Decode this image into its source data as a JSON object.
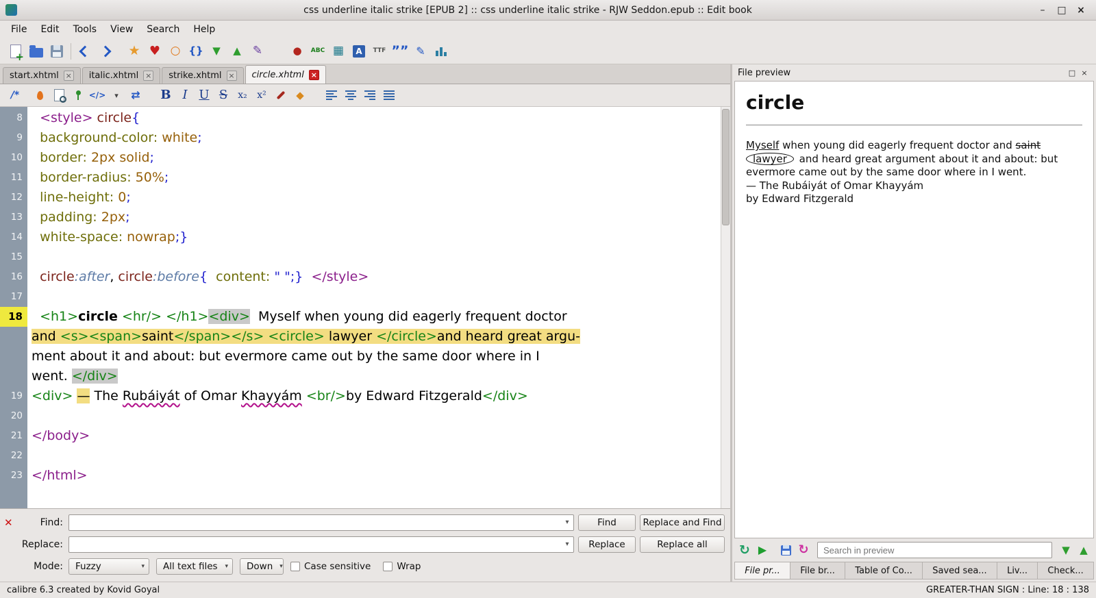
{
  "window": {
    "title": "css underline italic strike [EPUB 2] :: css underline italic strike - RJW Seddon.epub :: Edit book",
    "minimize": "–",
    "maximize": "□",
    "close": "×"
  },
  "menu": [
    "File",
    "Edit",
    "Tools",
    "View",
    "Search",
    "Help"
  ],
  "main_toolbar": [
    {
      "name": "new-file-icon",
      "cls": "ic-newdoc"
    },
    {
      "name": "open-book-icon",
      "cls": "ic-folder"
    },
    {
      "name": "save-icon",
      "cls": "ic-floppy"
    },
    {
      "sep": true
    },
    {
      "name": "back-icon",
      "cls": "ic-chev-l"
    },
    {
      "name": "forward-icon",
      "cls": "ic-chev-r"
    },
    {
      "gap": 12,
      "name": "bookmark-icon",
      "glyph": "★",
      "color": "#e69a2e",
      "size": 19
    },
    {
      "name": "donate-heart-icon",
      "glyph": "♥",
      "color": "#c81f1f",
      "size": 18
    },
    {
      "name": "sync-icon",
      "glyph": "○",
      "color": "#e07b1f",
      "size": 17,
      "bold": true
    },
    {
      "name": "braces-icon",
      "glyph": "{}",
      "color": "#2458c4",
      "size": 15,
      "bold": true
    },
    {
      "name": "arrow-down-icon",
      "glyph": "▼",
      "color": "#2f9e2f",
      "size": 15
    },
    {
      "name": "arrow-up-icon",
      "glyph": "▲",
      "color": "#2f9e2f",
      "size": 15
    },
    {
      "name": "quill-icon",
      "glyph": "✎",
      "color": "#6a3fa0",
      "size": 17
    },
    {
      "gap": 28,
      "name": "check-book-icon",
      "glyph": "●",
      "color": "#b3261e",
      "size": 15
    },
    {
      "name": "spellcheck-icon",
      "glyph": "ABC",
      "color": "#1a7d1a",
      "size": 9,
      "bold": true
    },
    {
      "name": "table-icon",
      "glyph": "▦",
      "color": "#1f7a8c",
      "size": 17
    },
    {
      "name": "manage-fonts-icon",
      "cls": "ic-sqA",
      "glyph": "A"
    },
    {
      "name": "subset-fonts-icon",
      "glyph": "TTF",
      "color": "#50524f",
      "size": 9,
      "bold": true
    },
    {
      "name": "smarten-punctuation-icon",
      "glyph": "””",
      "color": "#2458c4",
      "size": 19,
      "bold": true
    },
    {
      "name": "fix-html-icon",
      "glyph": "✎",
      "color": "#2458c4",
      "size": 16
    },
    {
      "name": "reports-icon",
      "cls": "ic-bars"
    }
  ],
  "tabs": [
    {
      "label": "start.xhtml",
      "active": false,
      "modified": false
    },
    {
      "label": "italic.xhtml",
      "active": false,
      "modified": false
    },
    {
      "label": "strike.xhtml",
      "active": false,
      "modified": false
    },
    {
      "label": "circle.xhtml",
      "active": true,
      "modified": true
    }
  ],
  "editor_toolbar": [
    {
      "name": "comment-icon",
      "glyph": "/*",
      "color": "#2458c4",
      "size": 14,
      "bold": true,
      "italic": true
    },
    {
      "gap": 8,
      "name": "match-icon",
      "cls": "ic-drop"
    },
    {
      "name": "search-file-icon",
      "cls": "ic-magdoc"
    },
    {
      "name": "insert-snippet-icon",
      "cls": "ic-sprout"
    },
    {
      "name": "code-tag-icon",
      "glyph": "</>",
      "color": "#2458c4",
      "size": 12,
      "bold": true
    },
    {
      "name": "code-tag-dropdown-icon",
      "glyph": "▾",
      "color": "#444444",
      "size": 11
    },
    {
      "name": "swap-icon",
      "glyph": "⇄",
      "color": "#2458c4",
      "size": 16,
      "bold": true
    },
    {
      "gap": 16,
      "name": "bold-icon",
      "glyph": "B",
      "color": "#1b3c8c",
      "size": 18,
      "bold": true,
      "serif": true
    },
    {
      "name": "italic-icon",
      "glyph": "I",
      "color": "#1b3c8c",
      "size": 18,
      "italic": true,
      "serif": true
    },
    {
      "name": "underline-icon",
      "glyph": "U",
      "color": "#1b3c8c",
      "size": 18,
      "serif": true,
      "deco": "underline"
    },
    {
      "name": "strikethrough-icon",
      "glyph": "S",
      "color": "#1b3c8c",
      "size": 18,
      "serif": true,
      "deco": "line-through"
    },
    {
      "name": "subscript-icon",
      "glyph": "x₂",
      "color": "#1b3c8c",
      "size": 14,
      "serif": true
    },
    {
      "name": "superscript-icon",
      "glyph": "x²",
      "color": "#1b3c8c",
      "size": 14,
      "serif": true
    },
    {
      "name": "foreground-color-icon",
      "cls": "ic-brush"
    },
    {
      "name": "background-color-icon",
      "glyph": "◆",
      "color": "#d98a1f",
      "size": 15
    },
    {
      "gap": 18,
      "name": "align-left-icon",
      "cls": "ic-align al-left"
    },
    {
      "name": "align-center-icon",
      "cls": "ic-align al-center"
    },
    {
      "name": "align-right-icon",
      "cls": "ic-align al-right"
    },
    {
      "name": "align-justify-icon",
      "cls": "ic-align al-just"
    }
  ],
  "editor": {
    "rows": [
      {
        "num": "8",
        "tokens": [
          {
            "t": "  "
          },
          {
            "t": "<style>",
            "c": "tp"
          },
          {
            "t": " "
          },
          {
            "t": "circle",
            "c": "se"
          },
          {
            "t": "{",
            "c": "pu"
          }
        ]
      },
      {
        "num": "9",
        "tokens": [
          {
            "t": "  "
          },
          {
            "t": "background-color:",
            "c": "pr"
          },
          {
            "t": " "
          },
          {
            "t": "white",
            "c": "vl"
          },
          {
            "t": ";",
            "c": "pu"
          }
        ]
      },
      {
        "num": "10",
        "tokens": [
          {
            "t": "  "
          },
          {
            "t": "border:",
            "c": "pr"
          },
          {
            "t": " "
          },
          {
            "t": "2px",
            "c": "vl"
          },
          {
            "t": " "
          },
          {
            "t": "solid",
            "c": "vl"
          },
          {
            "t": ";",
            "c": "pu"
          }
        ]
      },
      {
        "num": "11",
        "tokens": [
          {
            "t": "  "
          },
          {
            "t": "border-radius:",
            "c": "pr"
          },
          {
            "t": " "
          },
          {
            "t": "50%",
            "c": "vl"
          },
          {
            "t": ";",
            "c": "pu"
          }
        ]
      },
      {
        "num": "12",
        "tokens": [
          {
            "t": "  "
          },
          {
            "t": "line-height:",
            "c": "pr"
          },
          {
            "t": " "
          },
          {
            "t": "0",
            "c": "vl"
          },
          {
            "t": ";",
            "c": "pu"
          }
        ]
      },
      {
        "num": "13",
        "tokens": [
          {
            "t": "  "
          },
          {
            "t": "padding:",
            "c": "pr"
          },
          {
            "t": " "
          },
          {
            "t": "2px",
            "c": "vl"
          },
          {
            "t": ";",
            "c": "pu"
          }
        ]
      },
      {
        "num": "14",
        "tokens": [
          {
            "t": "  "
          },
          {
            "t": "white-space:",
            "c": "pr"
          },
          {
            "t": " "
          },
          {
            "t": "nowrap",
            "c": "vl"
          },
          {
            "t": ";}",
            "c": "pu"
          }
        ]
      },
      {
        "num": "15",
        "tokens": []
      },
      {
        "num": "16",
        "tokens": [
          {
            "t": "  "
          },
          {
            "t": "circle",
            "c": "se"
          },
          {
            "t": ":after",
            "c": "ps"
          },
          {
            "t": ", "
          },
          {
            "t": "circle",
            "c": "se"
          },
          {
            "t": ":before",
            "c": "ps"
          },
          {
            "t": "{",
            "c": "pu"
          },
          {
            "t": "  "
          },
          {
            "t": "content:",
            "c": "pr"
          },
          {
            "t": " "
          },
          {
            "t": "\" \"",
            "c": "st"
          },
          {
            "t": ";}",
            "c": "pu"
          },
          {
            "t": "  "
          },
          {
            "t": "</style>",
            "c": "tp"
          }
        ]
      },
      {
        "num": "17",
        "tokens": []
      },
      {
        "num": "18",
        "cur": true,
        "tokens": [
          {
            "t": "  "
          },
          {
            "t": "<h1>",
            "c": "tg"
          },
          {
            "t": "circle",
            "c": "b"
          },
          {
            "t": " "
          },
          {
            "t": "<hr/>",
            "c": "tg"
          },
          {
            "t": " "
          },
          {
            "t": "</h1>",
            "c": "tg"
          },
          {
            "t": "<div>",
            "c": "tg bgg"
          },
          {
            "t": "  Myself when young did eagerly frequent doctor"
          }
        ]
      },
      {
        "tokens": [
          {
            "t": "and ",
            "c": "bgy"
          },
          {
            "t": "<s>",
            "c": "tg bgy"
          },
          {
            "t": "<span>",
            "c": "tg bgy"
          },
          {
            "t": "saint",
            "c": "bgy"
          },
          {
            "t": "</span>",
            "c": "tg bgy"
          },
          {
            "t": "</s>",
            "c": "tg bgy"
          },
          {
            "t": " ",
            "c": "bgy"
          },
          {
            "t": "<circle>",
            "c": "tg bgy"
          },
          {
            "t": " lawyer ",
            "c": "bgy"
          },
          {
            "t": "</circle>",
            "c": "tg bgy"
          },
          {
            "t": "and heard great argu-",
            "c": "bgy"
          }
        ]
      },
      {
        "tokens": [
          {
            "t": "ment about it and about: but evermore came out by the same door where in I"
          }
        ]
      },
      {
        "tokens": [
          {
            "t": "went. "
          },
          {
            "t": "</div>",
            "c": "tg bgg"
          }
        ]
      },
      {
        "num": "19",
        "tokens": [
          {
            "t": "<div>",
            "c": "tg"
          },
          {
            "t": " "
          },
          {
            "t": "—",
            "c": "bgy"
          },
          {
            "t": " The "
          },
          {
            "t": "Rubáiyát",
            "c": "sq"
          },
          {
            "t": " of Omar "
          },
          {
            "t": "Khayyám",
            "c": "sq"
          },
          {
            "t": " "
          },
          {
            "t": "<br/>",
            "c": "tg"
          },
          {
            "t": "by Edward Fitzgerald"
          },
          {
            "t": "</div>",
            "c": "tg"
          }
        ]
      },
      {
        "num": "20",
        "tokens": []
      },
      {
        "num": "21",
        "tokens": [
          {
            "t": "</body>",
            "c": "tp"
          }
        ]
      },
      {
        "num": "22",
        "tokens": []
      },
      {
        "num": "23",
        "tokens": [
          {
            "t": "</html>",
            "c": "tp"
          }
        ]
      }
    ]
  },
  "find_panel": {
    "close_glyph": "✕",
    "find_label": "Find:",
    "replace_label": "Replace:",
    "mode_label": "Mode:",
    "find_value": "",
    "replace_value": "",
    "find_button": "Find",
    "replace_and_find_button": "Replace and Find",
    "replace_button": "Replace",
    "replace_all_button": "Replace all",
    "mode_value": "Fuzzy",
    "scope_value": "All text files",
    "direction_value": "Down",
    "case_sensitive_label": "Case sensitive",
    "wrap_label": "Wrap"
  },
  "preview": {
    "panel_title": "File preview",
    "float_glyph": "□",
    "close_glyph": "×",
    "heading": "circle",
    "lines": [
      [
        {
          "t": "Myself",
          "st": "u"
        },
        {
          "t": " when young did eagerly frequent doctor and "
        },
        {
          "t": "saint",
          "st": "s"
        }
      ],
      [
        {
          "t": "lawyer",
          "st": "o"
        },
        {
          "t": " and heard great argument about it and about: but"
        }
      ],
      [
        {
          "t": "evermore came out by the same door where in I went."
        }
      ],
      [
        {
          "t": "— The Rubáiyát of Omar Khayyám"
        }
      ],
      [
        {
          "t": "by Edward Fitzgerald"
        }
      ]
    ],
    "controls_left": [
      {
        "name": "refresh-preview-icon",
        "glyph": "↻",
        "color": "#1f9e64",
        "size": 19,
        "bold": true
      },
      {
        "name": "run-preview-icon",
        "glyph": "▶",
        "color": "#1f9e2f",
        "size": 16
      },
      {
        "gap": 8,
        "name": "save-preview-icon",
        "cls": "ic-floppy-sm"
      },
      {
        "name": "reload-icon",
        "glyph": "↻",
        "color": "#cc2fa0",
        "size": 18,
        "bold": true
      }
    ],
    "controls_right": [
      {
        "name": "search-down-icon",
        "glyph": "▼",
        "color": "#2f9e2f",
        "size": 15
      },
      {
        "name": "search-up-icon",
        "glyph": "▲",
        "color": "#2f9e2f",
        "size": 15
      }
    ],
    "search_placeholder": "Search in preview",
    "bottom_tabs": [
      {
        "label": "File pr...",
        "active": true
      },
      {
        "label": "File br...",
        "active": false
      },
      {
        "label": "Table of Co...",
        "active": false
      },
      {
        "label": "Saved sea...",
        "active": false
      },
      {
        "label": "Liv...",
        "active": false
      },
      {
        "label": "Check...",
        "active": false
      }
    ]
  },
  "icons": {
    "dropdown_arrow": "▾"
  },
  "statusbar": {
    "left": "calibre 6.3 created by Kovid Goyal",
    "right": "GREATER-THAN SIGN : Line: 18 : 138"
  }
}
